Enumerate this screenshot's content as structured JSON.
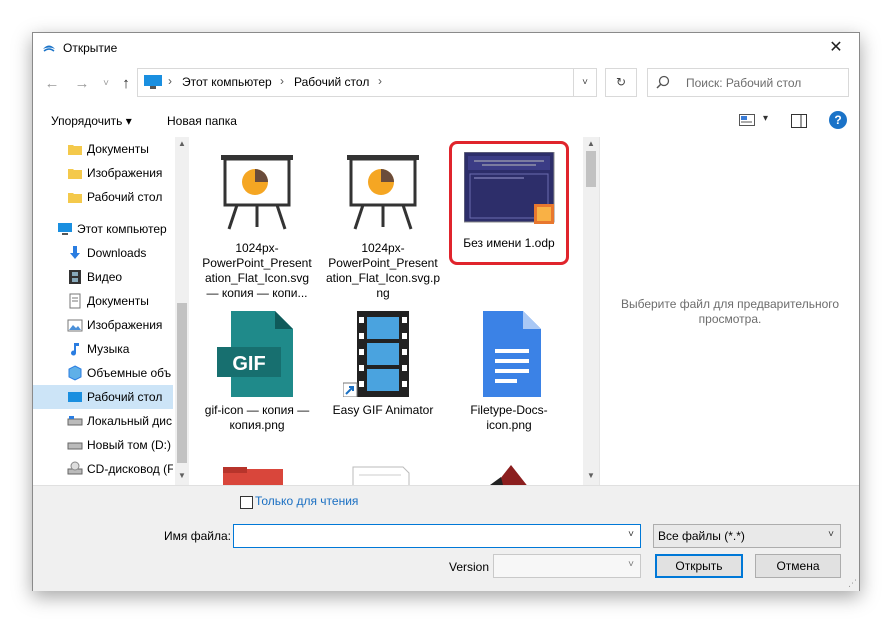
{
  "window": {
    "title": "Открытие",
    "close_glyph": "✕"
  },
  "nav": {
    "back_glyph": "←",
    "forward_glyph": "→",
    "recent_glyph": "˅",
    "up_glyph": "↑",
    "breadcrumbs": [
      "Этот компьютер",
      "Рабочий стол"
    ],
    "separator": "›",
    "dropdown_glyph": "˅",
    "refresh_glyph": "↻",
    "search_placeholder": "Поиск: Рабочий стол"
  },
  "toolbar": {
    "organize_label": "Упорядочить ▾",
    "new_folder_label": "Новая папка",
    "view_dropdown_glyph": "▾",
    "help_glyph": "?"
  },
  "sidebar": {
    "items": [
      {
        "label": "Документы",
        "icon": "folder-icon"
      },
      {
        "label": "Изображения",
        "icon": "folder-icon"
      },
      {
        "label": "Рабочий стол",
        "icon": "folder-icon"
      },
      {
        "label": "Этот компьютер",
        "icon": "computer-icon"
      },
      {
        "label": "Downloads",
        "icon": "download-arrow-icon"
      },
      {
        "label": "Видео",
        "icon": "film-icon"
      },
      {
        "label": "Документы",
        "icon": "document-icon"
      },
      {
        "label": "Изображения",
        "icon": "picture-icon"
      },
      {
        "label": "Музыка",
        "icon": "music-note-icon"
      },
      {
        "label": "Объемные объ",
        "icon": "cube-icon"
      },
      {
        "label": "Рабочий стол",
        "icon": "desktop-icon",
        "selected": true
      },
      {
        "label": "Локальный дис",
        "icon": "drive-icon"
      },
      {
        "label": "Новый том (D:)",
        "icon": "drive-icon"
      },
      {
        "label": "CD-дисковод (F",
        "icon": "cd-drive-icon"
      }
    ]
  },
  "files": [
    {
      "name": "1024px-PowerPoint_Presentation_Flat_Icon.svg — копия — копи...",
      "icon": "presentation-easel-icon"
    },
    {
      "name": "1024px-PowerPoint_Presentation_Flat_Icon.svg.png",
      "icon": "presentation-easel-icon"
    },
    {
      "name": "Без имени 1.odp",
      "icon": "odp-slide-thumbnail",
      "highlighted": true
    },
    {
      "name": "gif-icon — копия — копия.png",
      "icon": "gif-file-icon"
    },
    {
      "name": "Easy GIF Animator",
      "icon": "film-strip-shortcut-icon"
    },
    {
      "name": "Filetype-Docs-icon.png",
      "icon": "google-docs-icon"
    }
  ],
  "preview": {
    "text": "Выберите файл для предварительного просмотра."
  },
  "bottom": {
    "readonly_label": "Только для чтения",
    "filename_label": "Имя файла:",
    "filename_value": "",
    "filetype_value": "Все файлы (*.*)",
    "version_label": "Version",
    "open_label": "Открыть",
    "cancel_label": "Отмена",
    "dropdown_glyph": "˅"
  },
  "colors": {
    "accent": "#0078d7",
    "selection": "#cce4f7",
    "highlight_ring": "#e0242c"
  }
}
